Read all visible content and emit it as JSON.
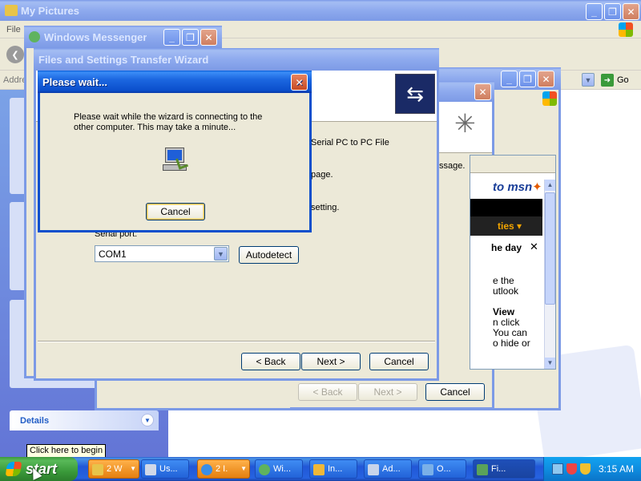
{
  "my_pictures": {
    "title": "My Pictures",
    "menu_file": "File",
    "address_label": "Addre",
    "go_label": "Go",
    "left_pane": {
      "details_label": "Details"
    },
    "tooltip": "Click here to begin"
  },
  "messenger": {
    "title": "Windows Messenger"
  },
  "bg_window": {
    "back_label": "< Back",
    "next_label": "Next >",
    "cancel_label": "Cancel",
    "text_message": "ssage.",
    "msn_logo": "msn",
    "msn_ties": "ties",
    "tip_title": "he day",
    "tip_text": [
      "e the",
      "utlook",
      "",
      "View",
      "n click",
      "You can",
      "o hide or"
    ]
  },
  "wizard": {
    "title": "Files and Settings Transfer Wizard",
    "text_serial": "Serial PC to PC File",
    "text_page": "page.",
    "text_setting": "setting.",
    "serial_port_label": "Serial port:",
    "serial_port_value": "COM1",
    "autodetect_label": "Autodetect",
    "back_label": "< Back",
    "next_label": "Next >",
    "cancel_label": "Cancel"
  },
  "please_wait": {
    "title": "Please wait...",
    "message": "Please wait while the wizard is connecting to the other computer. This may take a minute...",
    "cancel_label": "Cancel"
  },
  "taskbar": {
    "start_label": "start",
    "tasks": [
      {
        "label": "2 W",
        "icon_color": "#e8c44a"
      },
      {
        "label": "Us...",
        "icon_color": "#d0d8e8"
      },
      {
        "label": "2 I.",
        "icon_color": "#3a8ee6"
      },
      {
        "label": "Wi...",
        "icon_color": "#5fb35f"
      },
      {
        "label": "In...",
        "icon_color": "#f0b838"
      },
      {
        "label": "Ad...",
        "icon_color": "#c8d4ea"
      },
      {
        "label": "O...",
        "icon_color": "#7ab0e8"
      },
      {
        "label": "Fi...",
        "icon_color": "#5aa25a"
      }
    ],
    "clock": "3:15 AM"
  },
  "colors": {
    "xp_blue": "#0b4fcc",
    "xp_face": "#ece9d8",
    "start_green": "#3a9a3a",
    "close_red": "#c74b24"
  }
}
